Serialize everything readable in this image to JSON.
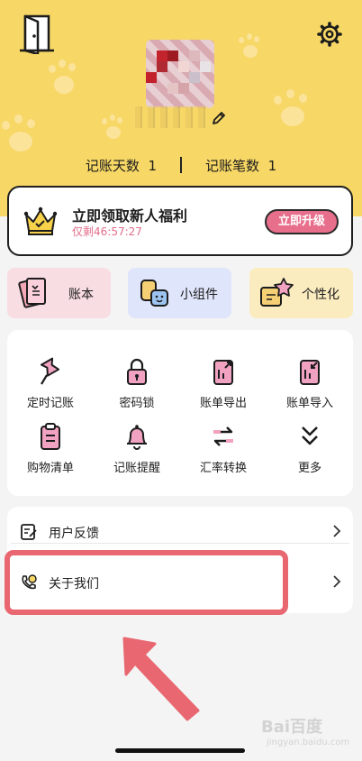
{
  "profile": {
    "stats": [
      {
        "label": "记账天数",
        "value": "1"
      },
      {
        "label": "记账笔数",
        "value": "1"
      }
    ]
  },
  "promo": {
    "title": "立即领取新人福利",
    "timer": "仅剩46:57:27",
    "button_label": "立即升级"
  },
  "tiles": [
    {
      "label": "账本",
      "icon": "ledger-book-icon",
      "color": "#f8dde3"
    },
    {
      "label": "小组件",
      "icon": "widget-icon",
      "color": "#dfe5fb"
    },
    {
      "label": "个性化",
      "icon": "personalize-star-icon",
      "color": "#fbecc0"
    }
  ],
  "features": [
    {
      "label": "定时记账",
      "icon": "pin-icon"
    },
    {
      "label": "密码锁",
      "icon": "lock-icon"
    },
    {
      "label": "账单导出",
      "icon": "export-icon"
    },
    {
      "label": "账单导入",
      "icon": "import-icon"
    },
    {
      "label": "购物清单",
      "icon": "clipboard-list-icon"
    },
    {
      "label": "记账提醒",
      "icon": "bell-icon"
    },
    {
      "label": "汇率转换",
      "icon": "exchange-arrows-icon"
    },
    {
      "label": "更多",
      "icon": "double-chevron-down-icon"
    }
  ],
  "list": [
    {
      "label": "用户反馈",
      "icon": "feedback-icon"
    },
    {
      "label": "关于我们",
      "icon": "about-phone-icon"
    }
  ],
  "watermark": {
    "text": "Bai百度",
    "sub": "jingyan.baidu.com"
  },
  "colors": {
    "header_bg": "#f7d765",
    "accent_pink": "#e76f8c",
    "highlight_red": "#e86770"
  }
}
